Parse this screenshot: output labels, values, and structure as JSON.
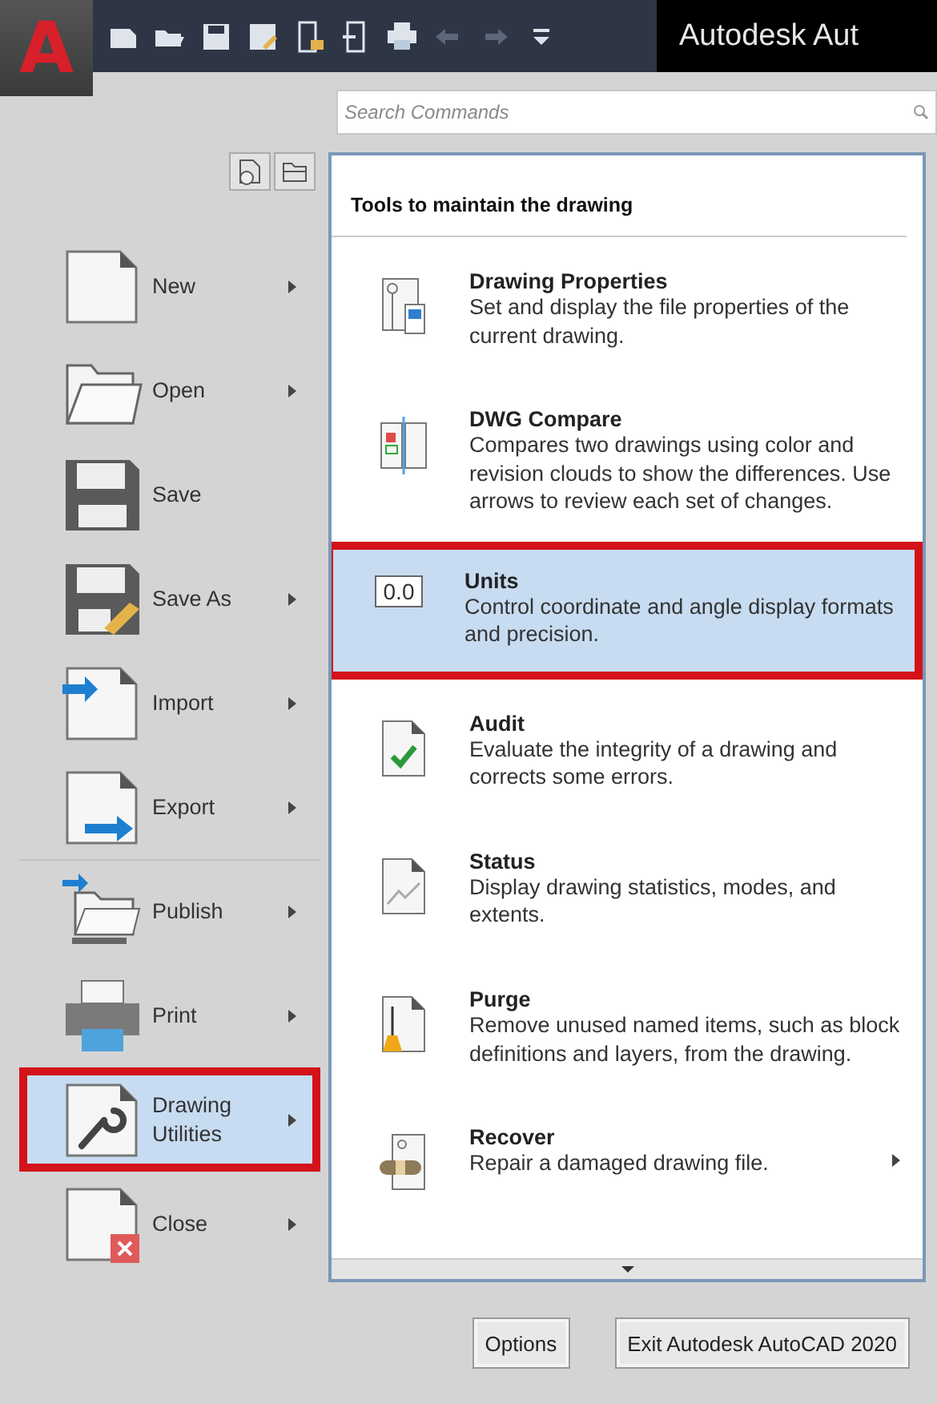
{
  "app_logo": "A",
  "window": {
    "title": "Autodesk Aut"
  },
  "search": {
    "placeholder": "Search Commands"
  },
  "menu": [
    {
      "label": "New",
      "has_submenu": true,
      "selected": false
    },
    {
      "label": "Open",
      "has_submenu": true,
      "selected": false
    },
    {
      "label": "Save",
      "has_submenu": false,
      "selected": false
    },
    {
      "label": "Save As",
      "has_submenu": true,
      "selected": false
    },
    {
      "label": "Import",
      "has_submenu": true,
      "selected": false
    },
    {
      "label": "Export",
      "has_submenu": true,
      "selected": false
    },
    {
      "label": "Publish",
      "has_submenu": true,
      "selected": false
    },
    {
      "label": "Print",
      "has_submenu": true,
      "selected": false
    },
    {
      "label": "Drawing Utilities",
      "has_submenu": true,
      "selected": true
    },
    {
      "label": "Close",
      "has_submenu": true,
      "selected": false
    }
  ],
  "panel": {
    "heading": "Tools to maintain the drawing",
    "items": [
      {
        "title": "Drawing Properties",
        "description": "Set and display the file properties of the current drawing.",
        "has_submenu": false,
        "selected": false
      },
      {
        "title": "DWG Compare",
        "description": "Compares two drawings using color and revision clouds to show the differences. Use arrows to review each set of changes.",
        "has_submenu": false,
        "selected": false
      },
      {
        "title": "Units",
        "description": "Control coordinate and angle display formats and precision.",
        "icon_text": "0.0",
        "has_submenu": false,
        "selected": true
      },
      {
        "title": "Audit",
        "description": "Evaluate the integrity of a drawing and corrects some errors.",
        "has_submenu": false,
        "selected": false
      },
      {
        "title": "Status",
        "description": "Display drawing statistics, modes, and extents.",
        "has_submenu": false,
        "selected": false
      },
      {
        "title": "Purge",
        "description": "Remove unused named items, such as block definitions and layers, from the drawing.",
        "has_submenu": false,
        "selected": false
      },
      {
        "title": "Recover",
        "description": "Repair a damaged drawing file.",
        "has_submenu": true,
        "selected": false
      }
    ]
  },
  "buttons": [
    "Options",
    "Exit Autodesk AutoCAD 2020"
  ]
}
